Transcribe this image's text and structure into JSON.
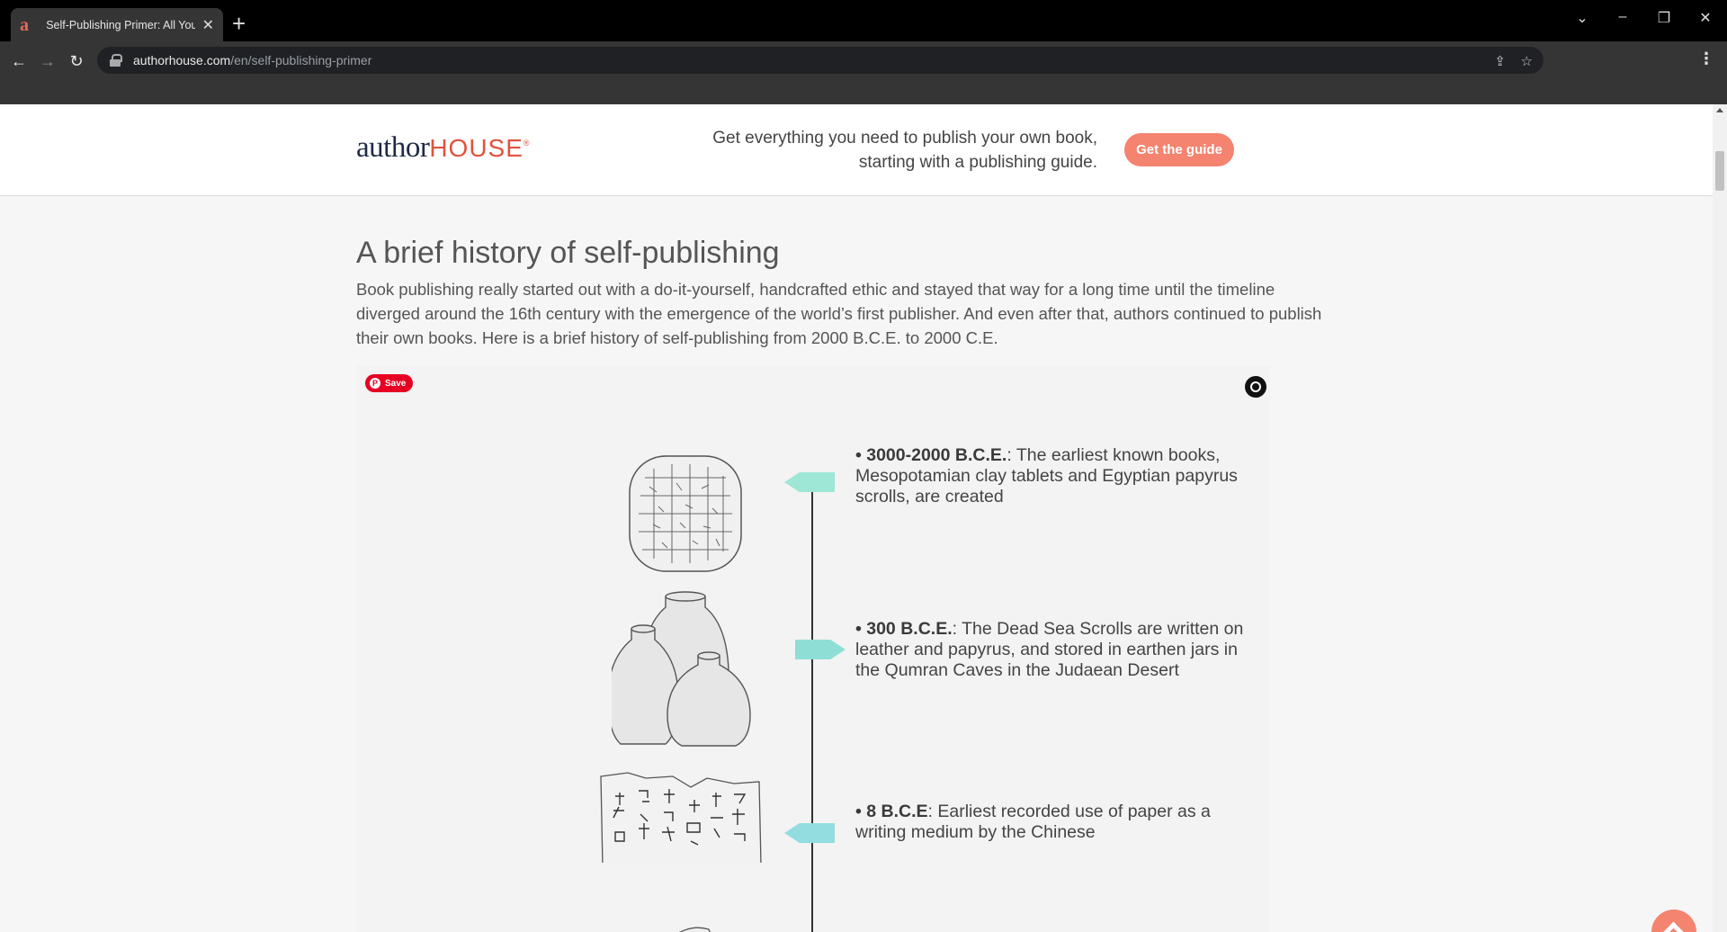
{
  "browser": {
    "tab_title": "Self-Publishing Primer: All You Ne",
    "tab_favicon": "a",
    "url_host": "authorhouse.com",
    "url_path": "/en/self-publishing-primer"
  },
  "header": {
    "logo_author": "author",
    "logo_house": "HOUSE",
    "promo_line1": "Get everything you need to publish your own book,",
    "promo_line2": "starting with a publishing guide.",
    "cta_label": "Get the guide"
  },
  "section": {
    "title": "A brief history of self-publishing",
    "intro": "Book publishing really started out with a do-it-yourself, handcrafted ethic and stayed that way for a long time until the timeline diverged around the 16th century with the emergence of the world’s first publisher. And even after that, authors continued to publish their own books. Here is a brief history of self-publishing from 2000 B.C.E. to 2000 C.E."
  },
  "infographic": {
    "save_label": "Save",
    "entries": [
      {
        "date": "• 3000-2000 B.C.E.",
        "text": ": The earliest known books, Mesopotamian clay tablets and Egyptian papyrus scrolls, are created",
        "flag_color": "#9ee6d5"
      },
      {
        "date": "• 300 B.C.E.",
        "text": ": The Dead Sea Scrolls are written on leather and papyrus, and stored in earthen jars in the Qumran Caves in the Judaean Desert",
        "flag_color": "#8fded6"
      },
      {
        "date": "• 8 B.C.E",
        "text": ": Earliest recorded use of paper as a writing medium by the Chinese",
        "flag_color": "#93dde0"
      }
    ]
  },
  "colors": {
    "accent": "#f4836f",
    "logo_navy": "#1f2a44",
    "logo_red": "#e0533d",
    "pinterest": "#e60023"
  }
}
